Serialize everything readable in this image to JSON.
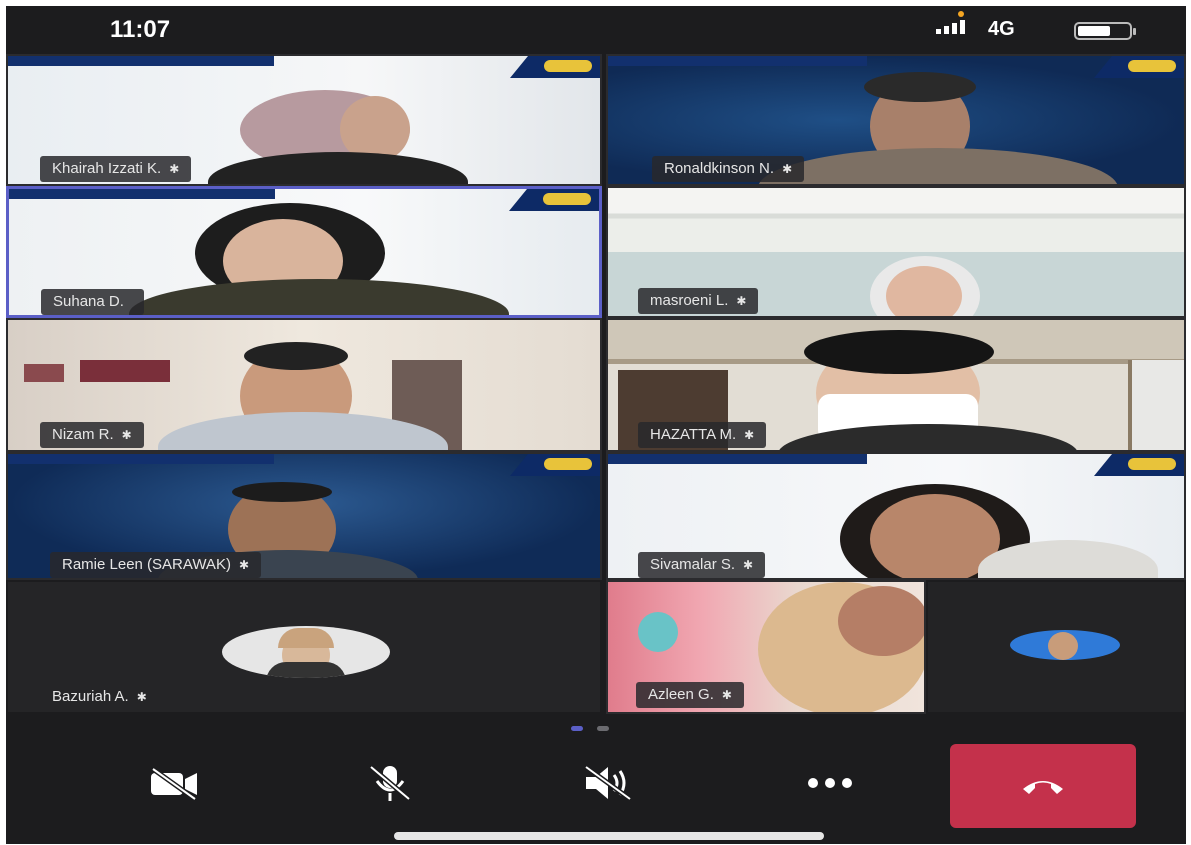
{
  "status_bar": {
    "time": "11:07",
    "network": "4G"
  },
  "participants": [
    {
      "name": "Khairah Izzati K.",
      "badge": "✱"
    },
    {
      "name": "Ronaldkinson N.",
      "badge": "✱"
    },
    {
      "name": "Suhana D.",
      "badge": ""
    },
    {
      "name": "masroeni L.",
      "badge": "✱"
    },
    {
      "name": "Nizam R.",
      "badge": "✱"
    },
    {
      "name": "HAZATTA M.",
      "badge": "✱"
    },
    {
      "name": "Ramie Leen (SARAWAK)",
      "badge": "✱"
    },
    {
      "name": "Sivamalar S.",
      "badge": "✱"
    },
    {
      "name": "Bazuriah A.",
      "badge": "✱"
    },
    {
      "name": "Azleen G.",
      "badge": "✱"
    }
  ],
  "pager": {
    "pages": 2,
    "current": 1
  },
  "colors": {
    "accent": "#5b5fc7",
    "hangup": "#c4314b",
    "background": "#1c1c1e"
  },
  "icons": {
    "camera": "camera-off-icon",
    "mic": "mic-off-icon",
    "speaker": "speaker-off-icon",
    "more": "more-options-icon",
    "hangup": "hang-up-icon"
  }
}
